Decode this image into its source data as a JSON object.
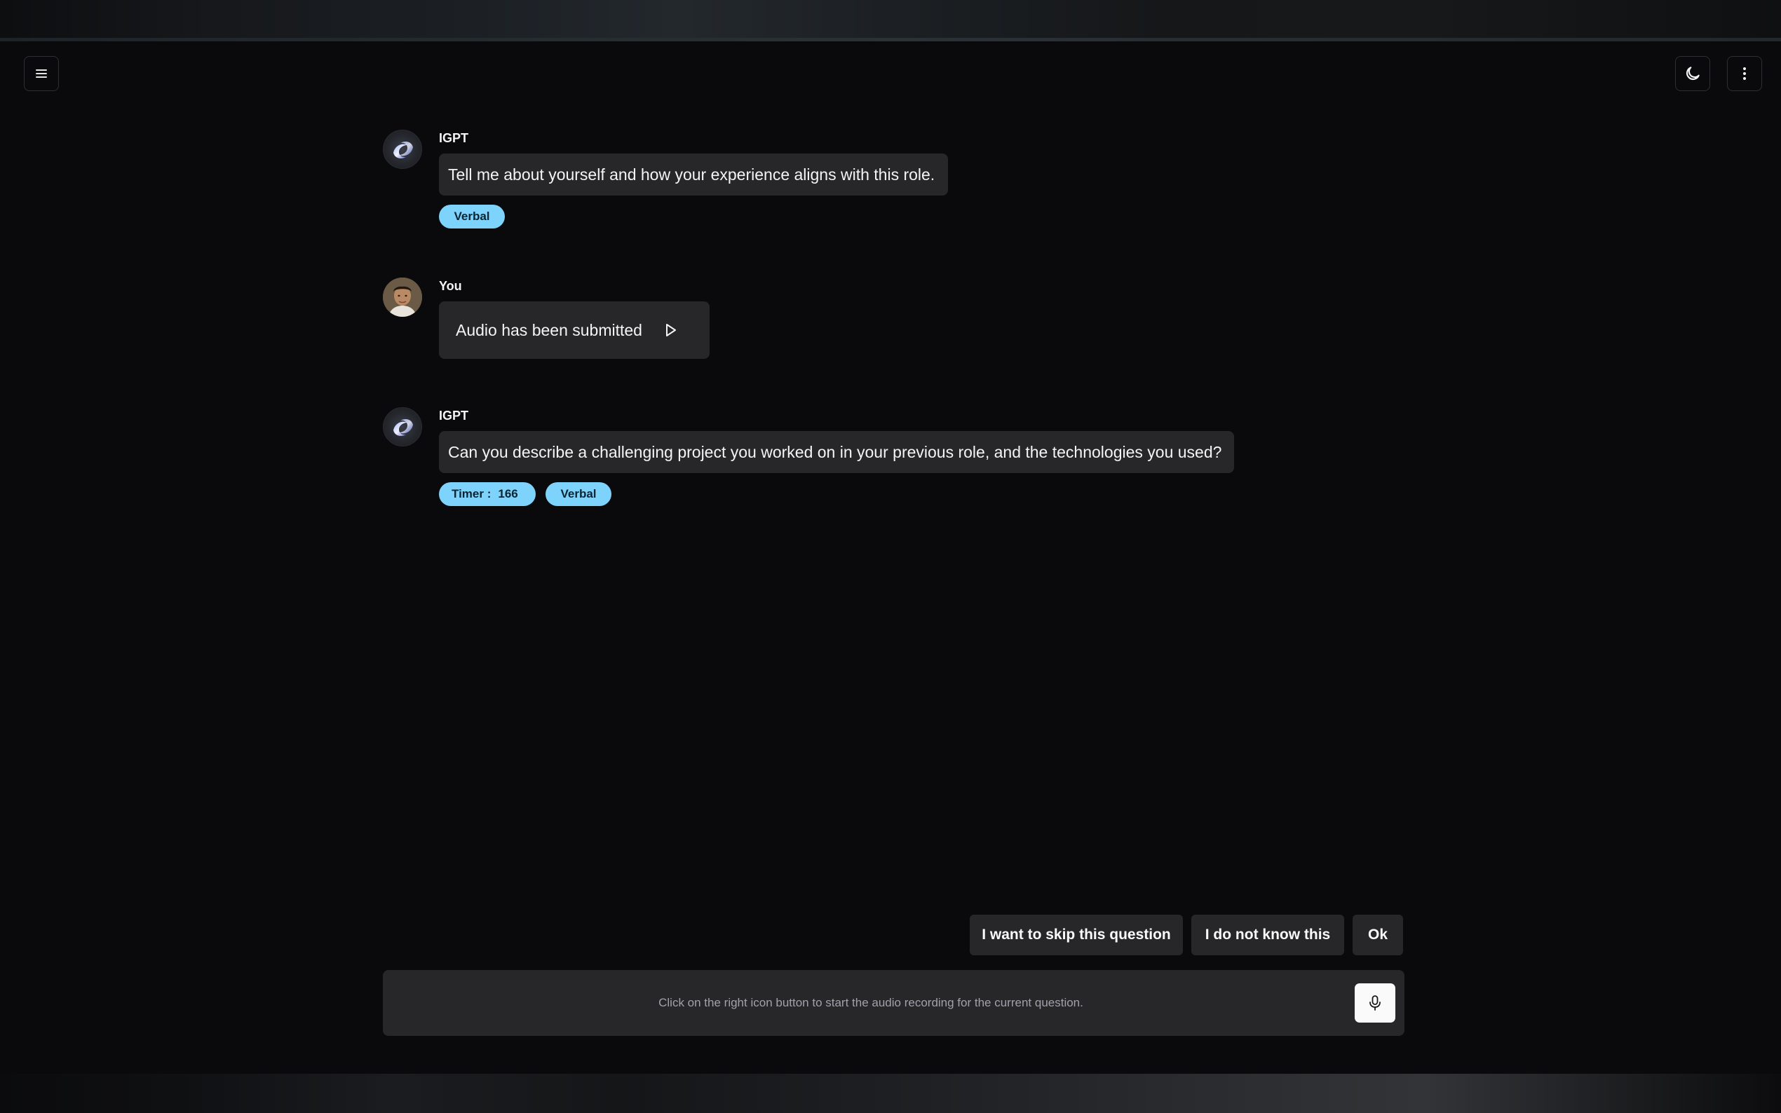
{
  "header": {
    "menu_icon": "hamburger-menu-icon",
    "theme_icon": "moon-icon",
    "more_icon": "vertical-dots-icon"
  },
  "messages": [
    {
      "sender": "IGPT",
      "avatar": "igpt-logo",
      "text": "Tell me about yourself and how your experience aligns with this role.",
      "tags": [
        "Verbal"
      ]
    },
    {
      "sender": "You",
      "avatar": "user-photo",
      "text": "Audio has been submitted",
      "action_icon": "play-icon"
    },
    {
      "sender": "IGPT",
      "avatar": "igpt-logo",
      "text": "Can you describe a challenging project you worked on in your previous role, and the technologies you used?",
      "timer_label": "Timer :",
      "timer_value": "166",
      "tags": [
        "Verbal"
      ]
    }
  ],
  "quick_replies": {
    "skip": "I want to skip this question",
    "dont_know": "I do not know this",
    "ok": "Ok"
  },
  "composer": {
    "hint": "Click on the right icon button to start the audio recording for the current question.",
    "mic_icon": "microphone-icon"
  },
  "colors": {
    "background": "#0a0a0c",
    "bubble": "#27272a",
    "tag": "#7dd3fc"
  }
}
